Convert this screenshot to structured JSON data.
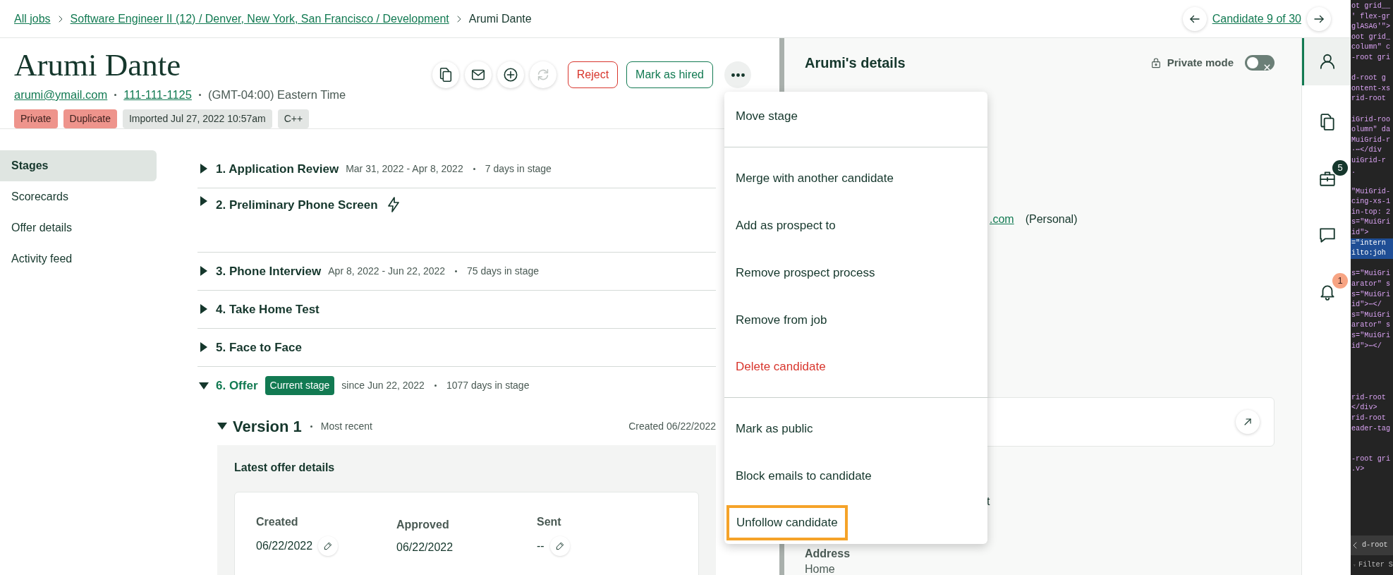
{
  "breadcrumb": [
    {
      "label": "All jobs",
      "link": true
    },
    {
      "label": "Software Engineer II (12) / Denver, New York, San Francisco / Development",
      "link": true
    },
    {
      "label": "Arumi Dante",
      "link": false
    }
  ],
  "candidate_nav": {
    "label": "Candidate 9 of 30"
  },
  "candidate": {
    "name": "Arumi Dante",
    "email": "arumi@ymail.com",
    "phone": "111-111-1125",
    "timezone": "(GMT-04:00) Eastern Time",
    "tags": [
      {
        "label": "Private",
        "kind": "alert"
      },
      {
        "label": "Duplicate",
        "kind": "alert"
      },
      {
        "label": "Imported Jul 27, 2022 10:57am",
        "kind": "info"
      },
      {
        "label": "C++",
        "kind": "info"
      }
    ]
  },
  "actions": [
    {
      "kind": "copy",
      "disabled": false
    },
    {
      "kind": "email",
      "disabled": false
    },
    {
      "kind": "add",
      "disabled": false
    },
    {
      "kind": "sync",
      "disabled": true
    },
    {
      "kind": "reject",
      "label": "Reject",
      "disabled": false
    },
    {
      "kind": "hire",
      "label": "Mark as hired",
      "disabled": false
    },
    {
      "kind": "more",
      "disabled": false
    }
  ],
  "sidebar": [
    {
      "label": "Stages",
      "selected": true
    },
    {
      "label": "Scorecards",
      "selected": false
    },
    {
      "label": "Offer details",
      "selected": false
    },
    {
      "label": "Activity feed",
      "selected": false
    }
  ],
  "stages": [
    {
      "title": "1. Application Review",
      "dates": "Mar 31, 2022 - Apr 8, 2022",
      "duration": "7 days in stage",
      "expanded": false,
      "current": false,
      "automated": false
    },
    {
      "title": "2. Preliminary Phone Screen",
      "expanded": false,
      "current": false,
      "automated": true
    },
    {
      "title": "3. Phone Interview",
      "dates": "Apr 8, 2022 - Jun 22, 2022",
      "duration": "75 days in stage",
      "expanded": false,
      "current": false,
      "automated": false
    },
    {
      "title": "4. Take Home Test",
      "expanded": false,
      "current": false,
      "automated": false
    },
    {
      "title": "5. Face to Face",
      "expanded": false,
      "current": false,
      "automated": false
    },
    {
      "title": "6. Offer",
      "badge": "Current stage",
      "dates": "since Jun 22, 2022",
      "duration": "1077 days in stage",
      "expanded": true,
      "current": true,
      "automated": false
    }
  ],
  "offer": {
    "version": "Version 1",
    "note": "Most recent",
    "created": "Created 06/22/2022",
    "expanded": true,
    "section_title": "Latest offer details",
    "fields": [
      {
        "label": "Created",
        "value": "06/22/2022",
        "editable": true
      },
      {
        "label": "Approved",
        "value": "06/22/2022",
        "editable": false
      },
      {
        "label": "Sent",
        "value": "--",
        "editable": true
      }
    ]
  },
  "details": {
    "title": "Arumi's details",
    "private_mode": {
      "label": "Private mode",
      "on": false
    },
    "email_fragment": ".com",
    "email_type": "(Personal)",
    "text_fragment": "t",
    "address_label": "Address",
    "address_value": "Home"
  },
  "menu": {
    "items": [
      {
        "label": "Move stage",
        "kind": "normal",
        "divider_after": true,
        "highlighted": false
      },
      {
        "label": "Merge with another candidate",
        "kind": "normal",
        "divider_after": false,
        "highlighted": false
      },
      {
        "label": "Add as prospect to",
        "kind": "normal",
        "divider_after": false,
        "highlighted": false
      },
      {
        "label": "Remove prospect process",
        "kind": "normal",
        "divider_after": false,
        "highlighted": false
      },
      {
        "label": "Remove from job",
        "kind": "normal",
        "divider_after": false,
        "highlighted": false
      },
      {
        "label": "Delete candidate",
        "kind": "danger",
        "divider_after": true,
        "highlighted": false
      },
      {
        "label": "Mark as public",
        "kind": "normal",
        "divider_after": false,
        "highlighted": false
      },
      {
        "label": "Block emails to candidate",
        "kind": "normal",
        "divider_after": false,
        "highlighted": false
      },
      {
        "label": "Unfollow candidate",
        "kind": "normal",
        "divider_after": false,
        "highlighted": true
      }
    ]
  },
  "rail": [
    {
      "kind": "profile",
      "selected": true
    },
    {
      "kind": "documents",
      "selected": false
    },
    {
      "kind": "jobs",
      "selected": false,
      "badge": "5",
      "color": "#15372c"
    },
    {
      "kind": "messages",
      "selected": false
    },
    {
      "kind": "notifications",
      "selected": false,
      "badge": "1",
      "color": "#f7a483"
    }
  ],
  "devtools": {
    "blocks": [
      [
        {
          "text": "ot grid__",
          "highlighted": false
        },
        {
          "text": "' flex-gr",
          "highlighted": false
        },
        {
          "text": " glASAG'\">",
          "highlighted": false
        },
        {
          "text": "oot grid_",
          "highlighted": false
        },
        {
          "text": "column\" c",
          "highlighted": false
        },
        {
          "text": "-root gri",
          "highlighted": false
        }
      ],
      [
        {
          "text": "d-root g",
          "highlighted": false
        },
        {
          "text": "ontent-xs",
          "highlighted": false
        },
        {
          "text": "rid-root ",
          "highlighted": false
        }
      ],
      [
        {
          "text": "iGrid-roo",
          "highlighted": false
        },
        {
          "text": "olumn\" da",
          "highlighted": false
        },
        {
          "text": "MuiGrid-r",
          "highlighted": false
        },
        {
          "text": "·⋯</div",
          "highlighted": false
        },
        {
          "text": "uiGrid-r",
          "highlighted": false
        },
        {
          "text": ".",
          "highlighted": false
        }
      ],
      [
        {
          "text": "\"MuiGrid-",
          "highlighted": false
        },
        {
          "text": "cing-xs-1",
          "highlighted": false
        },
        {
          "text": "in-top: 2",
          "highlighted": false
        },
        {
          "text": "s=\"MuiGri",
          "highlighted": false
        },
        {
          "text": "id\">",
          "highlighted": false
        },
        {
          "text": "=\"intern",
          "highlighted": true
        },
        {
          "text": "ilto:joh",
          "highlighted": true
        }
      ],
      [
        {
          "text": "s=\"MuiGri",
          "highlighted": false
        },
        {
          "text": "arator\" s",
          "highlighted": false
        },
        {
          "text": "s=\"MuiGri",
          "highlighted": false
        },
        {
          "text": "id\">⋯</",
          "highlighted": false
        },
        {
          "text": "s=\"MuiGri",
          "highlighted": false
        },
        {
          "text": "arator\" s",
          "highlighted": false
        },
        {
          "text": "s=\"MuiGri",
          "highlighted": false
        },
        {
          "text": "id\">⋯</",
          "highlighted": false
        }
      ],
      [
        {
          "text": "rid-root ",
          "highlighted": false
        },
        {
          "text": "</div>",
          "highlighted": false
        },
        {
          "text": "rid-root ",
          "highlighted": false
        },
        {
          "text": "eader-tag",
          "highlighted": false
        }
      ],
      [
        {
          "text": "-root gri",
          "highlighted": false
        },
        {
          "text": ".v>",
          "highlighted": false
        }
      ]
    ],
    "path": "d-root",
    "filter": "Filter S"
  }
}
